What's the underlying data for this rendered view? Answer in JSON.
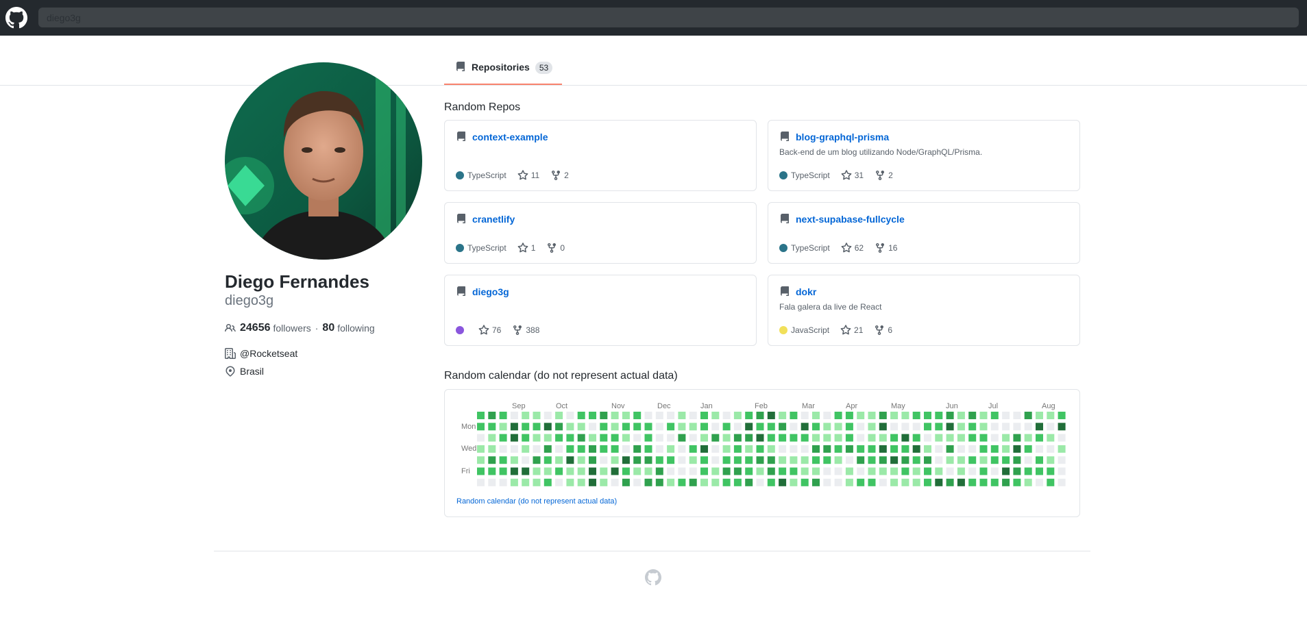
{
  "search": {
    "value": "diego3g"
  },
  "tab": {
    "label": "Repositories",
    "count": "53"
  },
  "profile": {
    "name": "Diego Fernandes",
    "login": "diego3g",
    "followers": "24656",
    "followers_label": "followers",
    "separator": "·",
    "following": "80",
    "following_label": "following",
    "company": "@Rocketseat",
    "location": "Brasil"
  },
  "repos_title": "Random Repos",
  "repos": [
    {
      "name": "context-example",
      "description": "",
      "language": "TypeScript",
      "lang_color": "#2b7489",
      "stars": "11",
      "forks": "2"
    },
    {
      "name": "blog-graphql-prisma",
      "description": "Back-end de um blog utilizando Node/GraphQL/Prisma.",
      "language": "TypeScript",
      "lang_color": "#2b7489",
      "stars": "31",
      "forks": "2"
    },
    {
      "name": "cranetlify",
      "description": "",
      "language": "TypeScript",
      "lang_color": "#2b7489",
      "stars": "1",
      "forks": "0"
    },
    {
      "name": "next-supabase-fullcycle",
      "description": "",
      "language": "TypeScript",
      "lang_color": "#2b7489",
      "stars": "62",
      "forks": "16"
    },
    {
      "name": "diego3g",
      "description": "",
      "language": "",
      "lang_color": "#8a56dd",
      "stars": "76",
      "forks": "388"
    },
    {
      "name": "dokr",
      "description": "Fala galera da live de React",
      "language": "JavaScript",
      "lang_color": "#f1e05a",
      "stars": "21",
      "forks": "6"
    }
  ],
  "calendar": {
    "title": "Random calendar (do not represent actual data)",
    "caption": "Random calendar (do not represent actual data)",
    "months": [
      "Sep",
      "Oct",
      "Nov",
      "Dec",
      "Jan",
      "Feb",
      "Mar",
      "Apr",
      "May",
      "Jun",
      "Jul",
      "Aug"
    ],
    "days": [
      "Mon",
      "Wed",
      "Fri"
    ],
    "colors": [
      "#ebedf0",
      "#9be9a8",
      "#40c463",
      "#30a14e",
      "#216e39"
    ]
  },
  "icons": {
    "logo": "github-logo-icon",
    "repo": "repo-icon",
    "star": "star-icon",
    "fork": "fork-icon",
    "people": "people-icon",
    "org": "organization-icon",
    "location": "location-icon"
  }
}
